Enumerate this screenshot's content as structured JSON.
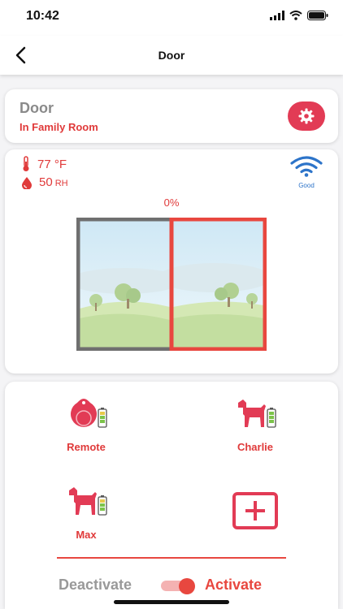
{
  "status_bar": {
    "time": "10:42"
  },
  "nav": {
    "title": "Door"
  },
  "device": {
    "name": "Door",
    "room": "In Family Room"
  },
  "sensors": {
    "temperature_value": "77",
    "temperature_unit": "°F",
    "humidity_value": "50",
    "humidity_unit": "RH",
    "wifi_status": "Good"
  },
  "window": {
    "open_percent_label": "0%",
    "open_fraction": 0.0
  },
  "devices": [
    {
      "label": "Remote",
      "icon": "remote-tag-icon"
    },
    {
      "label": "Charlie",
      "icon": "dog-icon"
    },
    {
      "label": "Max",
      "icon": "dog-icon"
    }
  ],
  "mode": {
    "deactivate_label": "Deactivate",
    "activate_label": "Activate",
    "active": true
  },
  "colors": {
    "accent": "#e8473f",
    "gear_bg": "#e23b55",
    "wifi": "#2d74c9"
  }
}
